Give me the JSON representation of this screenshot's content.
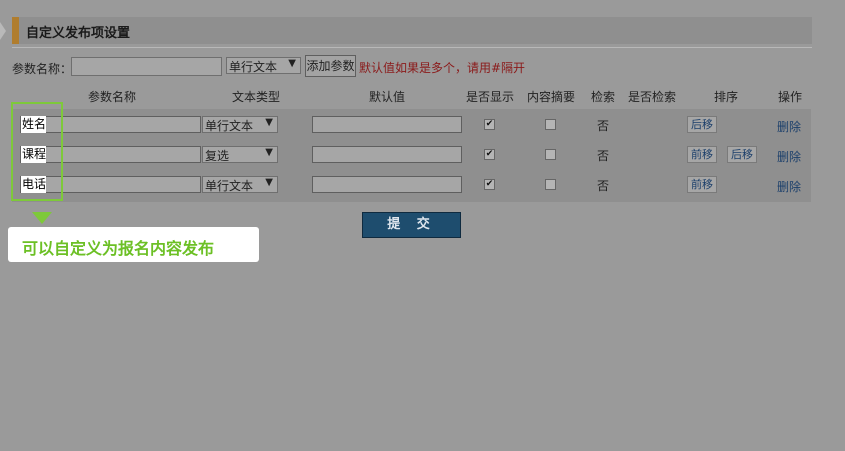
{
  "header": {
    "title": "自定义发布项设置"
  },
  "add_row": {
    "label": "参数名称：",
    "name_value": "",
    "type_value": "单行文本",
    "add_button": "添加参数",
    "hint": "默认值如果是多个，请用#隔开"
  },
  "columns": {
    "name": "参数名称",
    "type": "文本类型",
    "default": "默认值",
    "show": "是否显示",
    "summary": "内容摘要",
    "search": "检索",
    "is_search": "是否检索",
    "order": "排序",
    "ops": "操作"
  },
  "rows": [
    {
      "name": "姓名",
      "type": "单行文本",
      "default": "",
      "show": true,
      "summary": false,
      "search": "否",
      "order_buttons": [
        "后移"
      ],
      "delete": "删除"
    },
    {
      "name": "课程",
      "type": "复选",
      "default": "",
      "show": true,
      "summary": false,
      "search": "否",
      "order_buttons": [
        "前移",
        "后移"
      ],
      "delete": "删除"
    },
    {
      "name": "电话",
      "type": "单行文本",
      "default": "",
      "show": true,
      "summary": false,
      "search": "否",
      "order_buttons": [
        "前移"
      ],
      "delete": "删除"
    }
  ],
  "submit_label": "提 交",
  "callout": {
    "text": "可以自定义为报名内容发布"
  },
  "checkbox_glyph": "✔"
}
